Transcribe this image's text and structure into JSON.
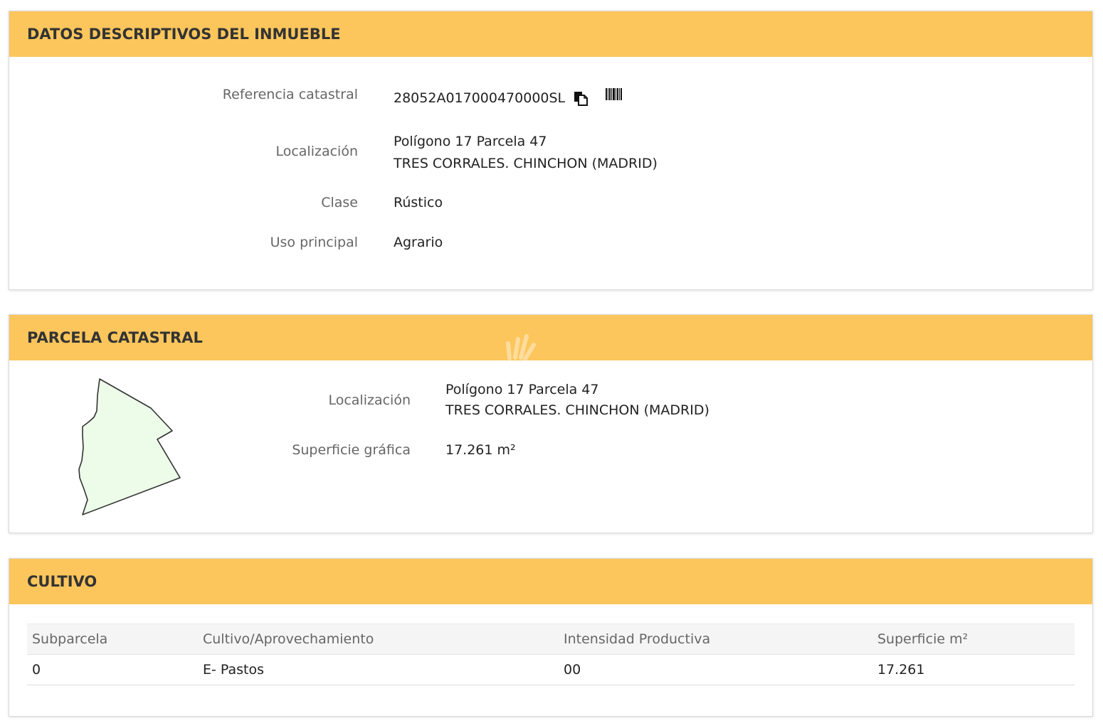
{
  "colors": {
    "header_bg": "#FCC65C",
    "header_text": "#333333",
    "label_text": "#666666",
    "value_text": "#222222",
    "parcel_fill": "#ECFCE9",
    "parcel_stroke": "#333333",
    "table_header_bg": "#F5F5F5"
  },
  "datos_descriptivos": {
    "title": "DATOS DESCRIPTIVOS DEL INMUEBLE",
    "referencia": {
      "label": "Referencia catastral",
      "value": "28052A017000470000SL",
      "copy_icon": "copy-icon",
      "barcode_icon": "barcode-icon"
    },
    "localizacion": {
      "label": "Localización",
      "lines": [
        "Polígono 17 Parcela 47",
        "TRES CORRALES. CHINCHON (MADRID)"
      ]
    },
    "clase": {
      "label": "Clase",
      "value": "Rústico"
    },
    "uso_principal": {
      "label": "Uso principal",
      "value": "Agrario"
    }
  },
  "parcela_catastral": {
    "title": "PARCELA CATASTRAL",
    "watermark_icon": "hand-watermark-icon",
    "parcel_shape": "parcel-outline-image",
    "localizacion": {
      "label": "Localización",
      "lines": [
        "Polígono 17 Parcela 47",
        "TRES CORRALES. CHINCHON (MADRID)"
      ]
    },
    "superficie_grafica": {
      "label": "Superficie gráfica",
      "value": "17.261 m²"
    }
  },
  "cultivo": {
    "title": "CULTIVO",
    "columns": [
      "Subparcela",
      "Cultivo/Aprovechamiento",
      "Intensidad Productiva",
      "Superficie m²"
    ],
    "rows": [
      [
        "0",
        "E- Pastos",
        "00",
        "17.261"
      ]
    ]
  }
}
